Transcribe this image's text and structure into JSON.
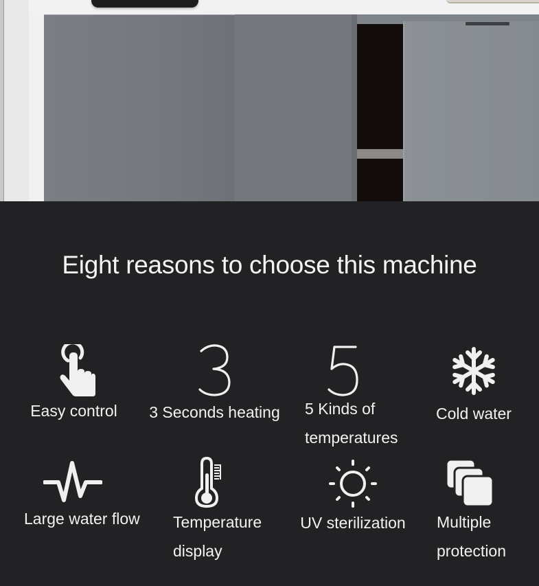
{
  "photo": {
    "description": "Grey cabinet with open door beneath a countertop water dispenser"
  },
  "features": {
    "title": "Eight reasons to choose this machine",
    "items": [
      {
        "icon": "touch-hand-icon",
        "label_lines": [
          "Easy control"
        ]
      },
      {
        "icon": "number-3-icon",
        "icon_text": "3",
        "label_lines": [
          "3 Seconds heating"
        ]
      },
      {
        "icon": "number-5-icon",
        "icon_text": "5",
        "label_lines": [
          "5  Kinds of",
          "temperatures"
        ]
      },
      {
        "icon": "snowflake-icon",
        "label_lines": [
          "Cold water"
        ]
      },
      {
        "icon": "waveform-icon",
        "label_lines": [
          "Large water flow"
        ]
      },
      {
        "icon": "thermometer-icon",
        "label_lines": [
          "Temperature",
          "display"
        ]
      },
      {
        "icon": "sun-icon",
        "label_lines": [
          "UV sterilization"
        ]
      },
      {
        "icon": "stacked-layers-icon",
        "label_lines": [
          "Multiple",
          "protection"
        ]
      }
    ]
  },
  "colors": {
    "background": "#222224",
    "foreground": "#f2f2f2",
    "cabinet_grey": "#7b7f84"
  }
}
